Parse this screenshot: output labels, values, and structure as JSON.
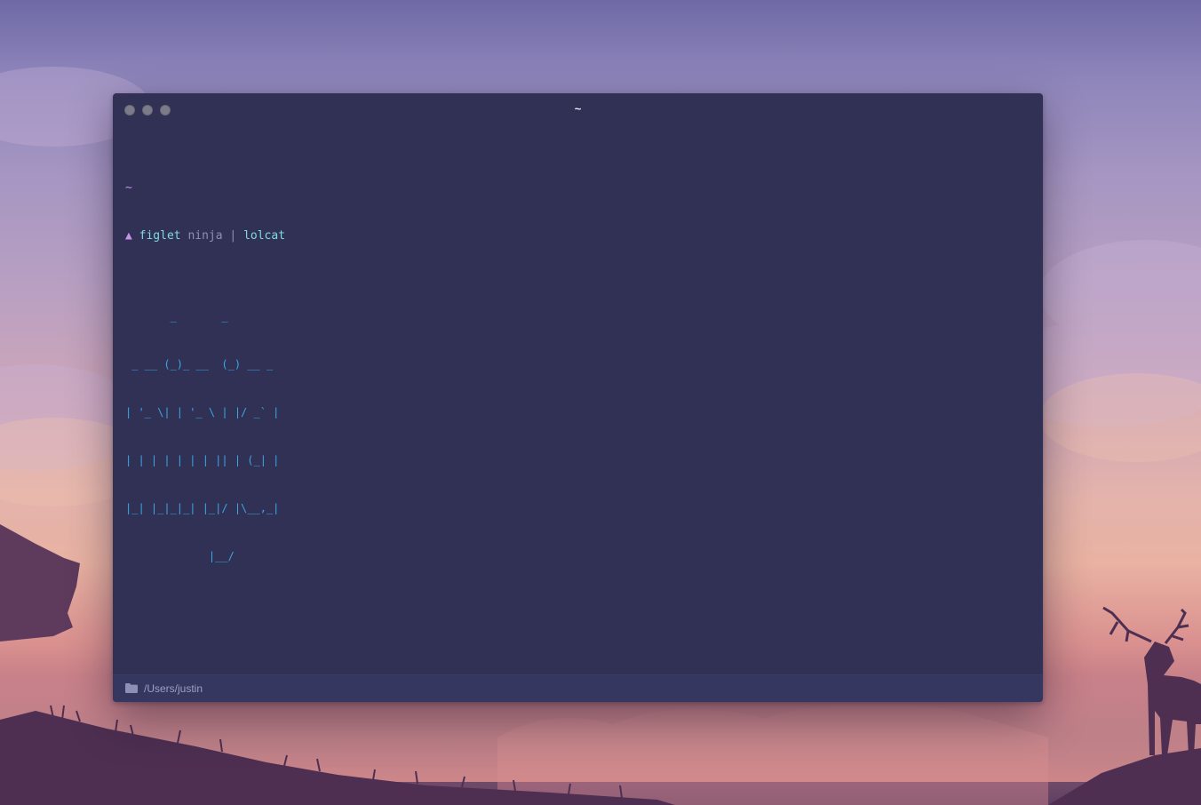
{
  "window": {
    "title": "~",
    "traffic_lights": [
      "close",
      "minimize",
      "maximize"
    ]
  },
  "terminal": {
    "first_prompt_dir": "~",
    "prompt_symbol": "▲",
    "command": "figlet",
    "argument": "ninja",
    "pipe": "|",
    "pipe_target": "lolcat",
    "figlet_output": [
      "       _       _",
      " _ __ (_)_ __  (_) __ _",
      "| '_ \\| | '_ \\ | |/ _` |",
      "| | | | | | | || | (_| |",
      "|_| |_|_|_| |_|/ |\\__,_|",
      "             |__/"
    ],
    "second_prompt_dir": "~"
  },
  "statusbar": {
    "icon": "folder-icon",
    "path": "/Users/justin"
  },
  "colors": {
    "terminal_bg": "#313156",
    "prompt": "#c792ea",
    "command": "#7fdbe0",
    "figlet": "#3aa6e6",
    "cursor": "#f6c96a"
  }
}
